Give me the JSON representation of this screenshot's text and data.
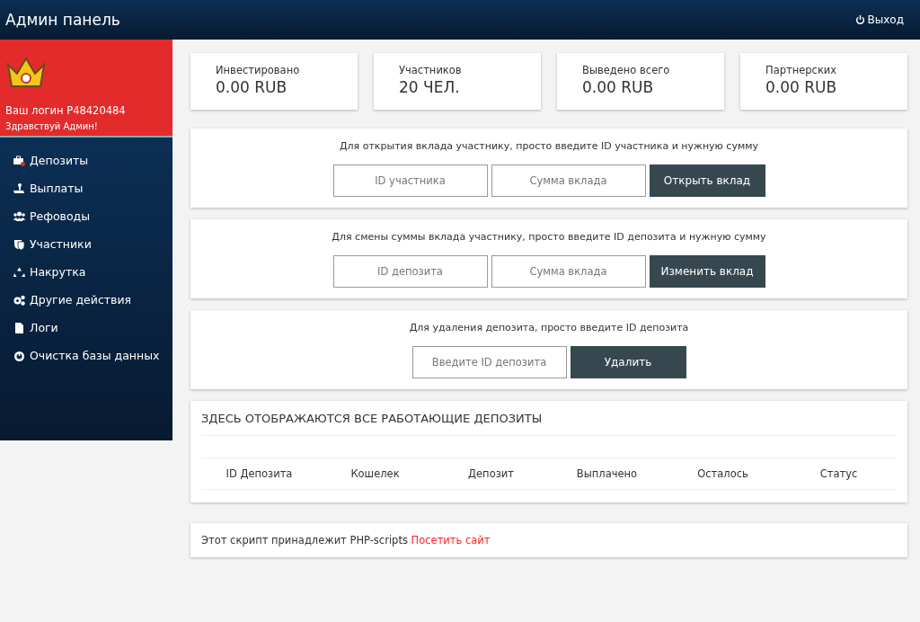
{
  "header": {
    "title": "Админ панель",
    "logout": "Выход"
  },
  "profile": {
    "login": "Ваш логин P48420484",
    "greeting": "Здравствуй Админ!"
  },
  "menu": [
    {
      "label": "Депозиты"
    },
    {
      "label": "Выплаты"
    },
    {
      "label": "Рефоводы"
    },
    {
      "label": "Участники"
    },
    {
      "label": "Накрутка"
    },
    {
      "label": "Другие действия"
    },
    {
      "label": "Логи"
    },
    {
      "label": "Очистка базы данных"
    }
  ],
  "stats": [
    {
      "label": "Инвестировано",
      "value": "0.00 RUB"
    },
    {
      "label": "Участников",
      "value": "20 ЧЕЛ."
    },
    {
      "label": "Выведено всего",
      "value": "0.00 RUB"
    },
    {
      "label": "Партнерских",
      "value": "0.00 RUB"
    }
  ],
  "forms": [
    {
      "text": "Для открытия вклада участнику, просто введите ID участника и нужную сумму",
      "fields": [
        {
          "placeholder": "ID участника"
        },
        {
          "placeholder": "Сумма вклада"
        }
      ],
      "button": "Открыть вклад"
    },
    {
      "text": "Для смены суммы вклада участнику, просто введите ID депозита и нужную сумму",
      "fields": [
        {
          "placeholder": "ID депозита"
        },
        {
          "placeholder": "Сумма вклада"
        }
      ],
      "button": "Изменить вклад"
    },
    {
      "text": "Для удаления депозита, просто введите ID депозита",
      "fields": [
        {
          "placeholder": "Введите ID депозита"
        }
      ],
      "button": "Удалить"
    }
  ],
  "deposits": {
    "title": "ЗДЕСЬ ОТОБРАЖАЮТСЯ ВСЕ РАБОТАЮЩИЕ ДЕПОЗИТЫ",
    "columns": [
      "ID Депозита",
      "Кошелек",
      "Депозит",
      "Выплачено",
      "Осталось",
      "Статус"
    ]
  },
  "footer": {
    "text": "Этот скрипт принадлежит PHP-scripts",
    "link": "Посетить сайт"
  }
}
